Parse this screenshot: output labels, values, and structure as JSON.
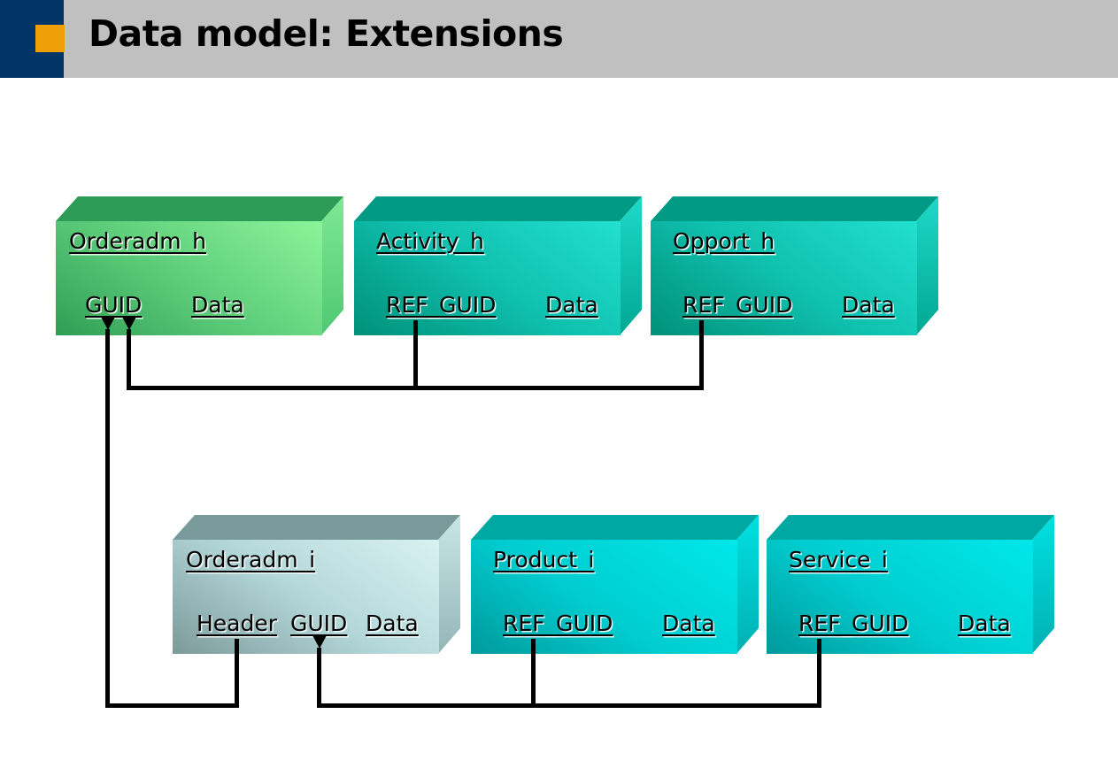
{
  "header": {
    "title": "Data model: Extensions",
    "bar_color": "#c0c0c0",
    "navy_color": "#013567",
    "accent_color": "#efa007"
  },
  "diagram": {
    "type": "entity-relationship",
    "boxes": [
      {
        "id": "orderadm_h",
        "title": "Orderadm_h",
        "fields": [
          "GUID",
          "Data"
        ],
        "row": "top",
        "front_color_dark": "#2f9e55",
        "front_color_light": "#8cf59a",
        "top_color": "#2d9c57",
        "side_color": "#6fe187"
      },
      {
        "id": "activity_h",
        "title": "Activity_h",
        "fields": [
          "REF_GUID",
          "Data"
        ],
        "row": "top",
        "front_color_dark": "#009078",
        "front_color_light": "#23e0cf",
        "top_color": "#009a85",
        "side_color": "#10c6b6"
      },
      {
        "id": "opport_h",
        "title": "Opport_h",
        "fields": [
          "REF_GUID",
          "Data"
        ],
        "row": "top",
        "front_color_dark": "#009078",
        "front_color_light": "#23e0cf",
        "top_color": "#009a85",
        "side_color": "#10c6b6"
      },
      {
        "id": "orderadm_i",
        "title": "Orderadm_i",
        "fields": [
          "Header",
          "GUID",
          "Data"
        ],
        "row": "bottom",
        "front_color_dark": "#7d9a9a",
        "front_color_light": "#d9f1f1",
        "top_color": "#799a9a",
        "side_color": "#b6d6d6"
      },
      {
        "id": "product_i",
        "title": "Product_i",
        "fields": [
          "REF_GUID",
          "Data"
        ],
        "row": "bottom",
        "front_color_dark": "#00a0a0",
        "front_color_light": "#00e8ea",
        "top_color": "#00a8a4",
        "side_color": "#00cfd2"
      },
      {
        "id": "service_i",
        "title": "Service_i",
        "fields": [
          "REF_GUID",
          "Data"
        ],
        "row": "bottom",
        "front_color_dark": "#00a0a0",
        "front_color_light": "#00e8ea",
        "top_color": "#00a8a4",
        "side_color": "#00cfd2"
      }
    ],
    "connections": [
      {
        "from": "activity_h.REF_GUID",
        "to": "orderadm_h.GUID",
        "arrow": "up"
      },
      {
        "from": "opport_h.REF_GUID",
        "to": "orderadm_h.GUID",
        "arrow": "up"
      },
      {
        "from": "orderadm_i.Header",
        "to": "orderadm_h.GUID",
        "arrow": "up"
      },
      {
        "from": "product_i.REF_GUID",
        "to": "orderadm_i.GUID",
        "arrow": "up"
      },
      {
        "from": "service_i.REF_GUID",
        "to": "orderadm_i.GUID",
        "arrow": "up"
      }
    ]
  }
}
